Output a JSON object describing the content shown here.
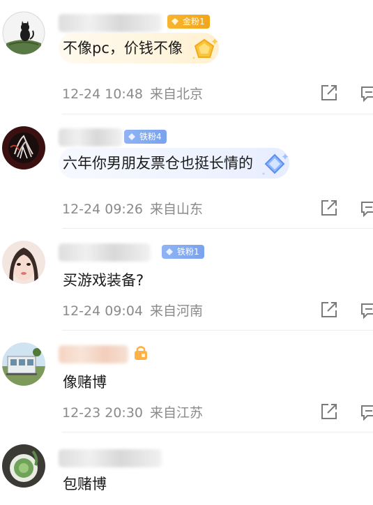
{
  "comments": [
    {
      "badge": "金粉1",
      "badge_type": "gold",
      "text": "不像pc，价钱不像",
      "date": "12-24 10:48",
      "location": "来自北京",
      "bubble_icon": "gold-gem-icon"
    },
    {
      "badge": "铁粉4",
      "badge_type": "iron",
      "text": "六年你男朋友票仓也挺长情的",
      "date": "12-24 09:26",
      "location": "来自山东",
      "bubble_icon": "blue-diamond-icon"
    },
    {
      "badge": "铁粉1",
      "badge_type": "iron",
      "text": "买游戏装备?",
      "date": "12-24 09:04",
      "location": "来自河南"
    },
    {
      "badge": "",
      "badge_type": "orange-lock",
      "text": "像赌博",
      "date": "12-23 20:30",
      "location": "来自江苏"
    },
    {
      "text": "包赌博"
    }
  ],
  "colors": {
    "gold_badge": "#f2a51a",
    "iron_badge": "#7aa3ee",
    "meta_text": "#8a8a8a"
  }
}
